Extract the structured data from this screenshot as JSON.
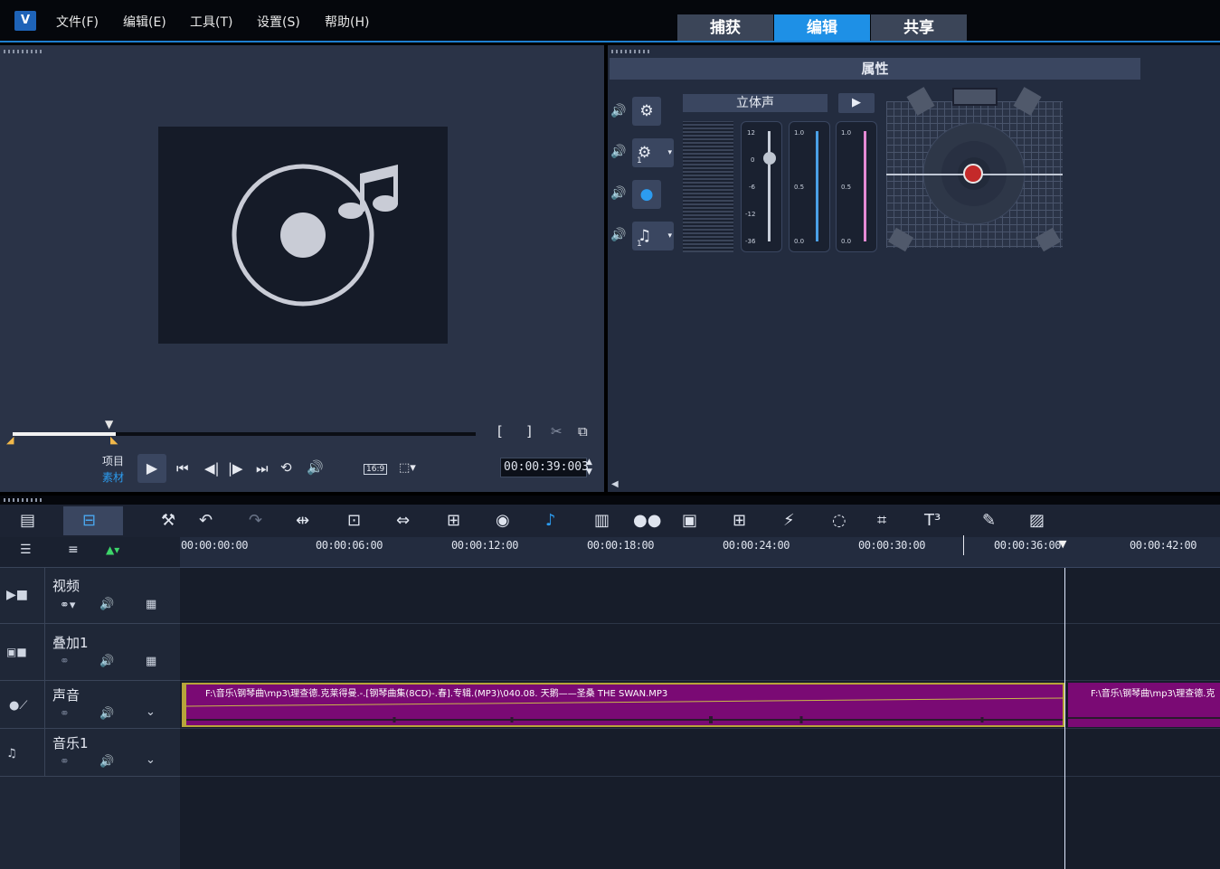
{
  "app": {
    "logo_text": "V"
  },
  "menu": {
    "file": "文件(F)",
    "edit": "编辑(E)",
    "tools": "工具(T)",
    "settings": "设置(S)",
    "help": "帮助(H)"
  },
  "tabs": {
    "capture": "捕获",
    "edit": "编辑",
    "share": "共享"
  },
  "player": {
    "project_label": "项目",
    "clip_label": "素材",
    "aspect": "16:9",
    "timecode": "00:00:39:003",
    "playhead_fraction": 0.22
  },
  "properties": {
    "title": "属性",
    "stereo_label": "立体声",
    "meter1_ticks": [
      "12",
      "0",
      "-6",
      "-12",
      "-36"
    ],
    "meter2_ticks": [
      "1.0",
      "0.5",
      "0.0"
    ],
    "meter3_ticks": [
      "1.0",
      "0.5",
      "0.0"
    ],
    "track_badge_1": "1",
    "track_badge_2": "1"
  },
  "timeline": {
    "ruler": [
      "00:00:00:00",
      "00:00:06:00",
      "00:00:12:00",
      "00:00:18:00",
      "00:00:24:00",
      "00:00:30:00",
      "00:00:36:00",
      "00:00:42:00"
    ],
    "tracks": [
      {
        "name": "视频"
      },
      {
        "name": "叠加1",
        "badge": "1"
      },
      {
        "name": "声音"
      },
      {
        "name": "音乐1",
        "badge": "1"
      }
    ],
    "clip1_title": "F:\\音乐\\钢琴曲\\mp3\\理查德.克莱得曼.-.[钢琴曲集(8CD)-.春].专辑.(MP3)\\040.08. 天鹅——圣桑 THE SWAN.MP3",
    "clip2_title": "F:\\音乐\\钢琴曲\\mp3\\理查德.克"
  },
  "colors": {
    "accent": "#1e90e6",
    "clip": "#7a0a74"
  }
}
